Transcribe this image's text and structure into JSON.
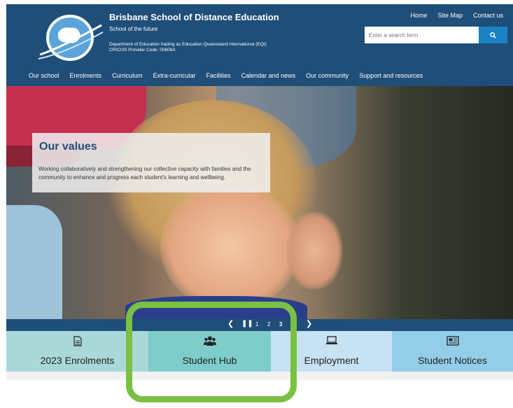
{
  "header": {
    "title": "Brisbane School of Distance Education",
    "tagline": "School of the future",
    "dept": "Department of Education trading as Education Queensland International (EQI)",
    "cricos": "CRICOS Provider Code: 00608A",
    "top_links": [
      "Home",
      "Site Map",
      "Contact us"
    ],
    "search": {
      "placeholder": "Enter a search term"
    }
  },
  "nav": [
    "Our school",
    "Enrolments",
    "Curriculum",
    "Extra-curricular",
    "Facilities",
    "Calendar and news",
    "Our community",
    "Support and resources"
  ],
  "hero": {
    "title": "Our values",
    "text": "Working collaboratively and strengthening our collective capacity with families and the community to enhance and progress each student's learning and wellbeing."
  },
  "slider": {
    "pages": [
      "1",
      "2",
      "3"
    ],
    "active_page": "3"
  },
  "tiles": [
    {
      "label": "2023 Enrolments",
      "icon": "document-icon"
    },
    {
      "label": "Student Hub",
      "icon": "users-icon"
    },
    {
      "label": "Employment",
      "icon": "laptop-icon"
    },
    {
      "label": "Student Notices",
      "icon": "newspaper-icon"
    }
  ],
  "colors": {
    "header_bg": "#1f4e79",
    "search_button": "#1b82c4",
    "highlight": "#7ac143"
  }
}
